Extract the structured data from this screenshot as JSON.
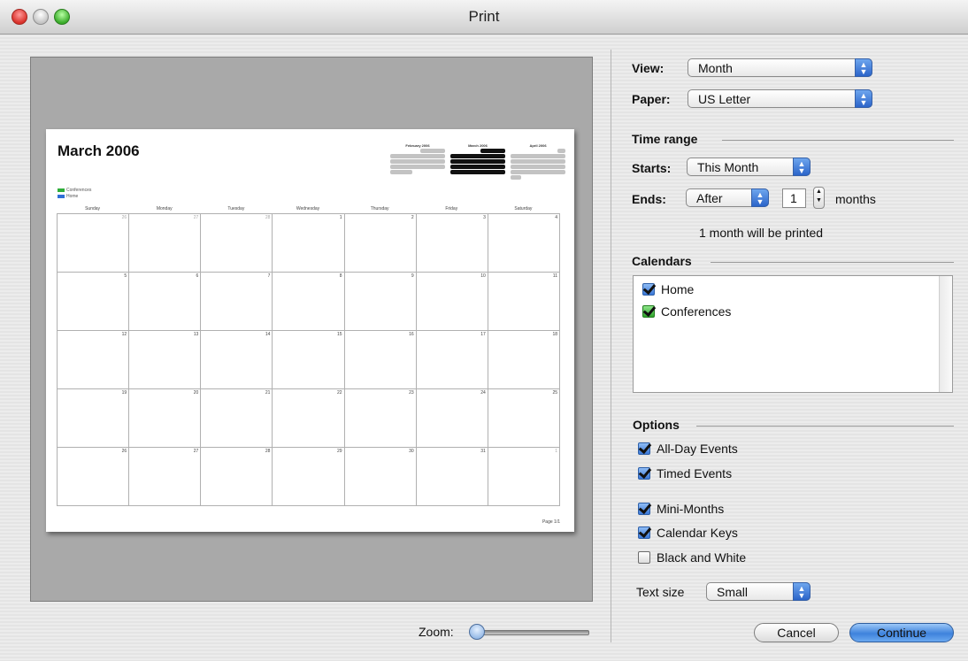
{
  "window": {
    "title": "Print"
  },
  "preview": {
    "calendar_title": "March 2006",
    "keys": [
      {
        "label": "Conferences",
        "color": "#2fae3a"
      },
      {
        "label": "Home",
        "color": "#2f6fd6"
      }
    ],
    "mini_months": [
      "February 2006",
      "March 2006",
      "April 2006"
    ],
    "day_headers": [
      "Sunday",
      "Monday",
      "Tuesday",
      "Wednesday",
      "Thursday",
      "Friday",
      "Saturday"
    ],
    "weeks": [
      [
        "26",
        "27",
        "28",
        "1",
        "2",
        "3",
        "4"
      ],
      [
        "5",
        "6",
        "7",
        "8",
        "9",
        "10",
        "11"
      ],
      [
        "12",
        "13",
        "14",
        "15",
        "16",
        "17",
        "18"
      ],
      [
        "19",
        "20",
        "21",
        "22",
        "23",
        "24",
        "25"
      ],
      [
        "26",
        "27",
        "28",
        "29",
        "30",
        "31",
        "1"
      ]
    ],
    "page_number": "Page 1/1"
  },
  "zoom": {
    "label": "Zoom:",
    "level": 0.0
  },
  "settings": {
    "view_label": "View:",
    "view_value": "Month",
    "paper_label": "Paper:",
    "paper_value": "US Letter",
    "time_range_heading": "Time range",
    "starts_label": "Starts:",
    "starts_value": "This Month",
    "ends_label": "Ends:",
    "ends_value": "After",
    "ends_count": "1",
    "ends_unit": "months",
    "summary": "1 month will be printed",
    "calendars_heading": "Calendars",
    "calendars": [
      {
        "name": "Home",
        "checked": true
      },
      {
        "name": "Conferences",
        "checked": true
      }
    ],
    "options_heading": "Options",
    "options": [
      {
        "label": "All-Day Events",
        "checked": true
      },
      {
        "label": "Timed Events",
        "checked": true
      },
      {
        "label": "Mini-Months",
        "checked": true
      },
      {
        "label": "Calendar Keys",
        "checked": true
      },
      {
        "label": "Black and White",
        "checked": false
      }
    ],
    "text_size_label": "Text size",
    "text_size_value": "Small"
  },
  "buttons": {
    "cancel": "Cancel",
    "continue": "Continue"
  }
}
